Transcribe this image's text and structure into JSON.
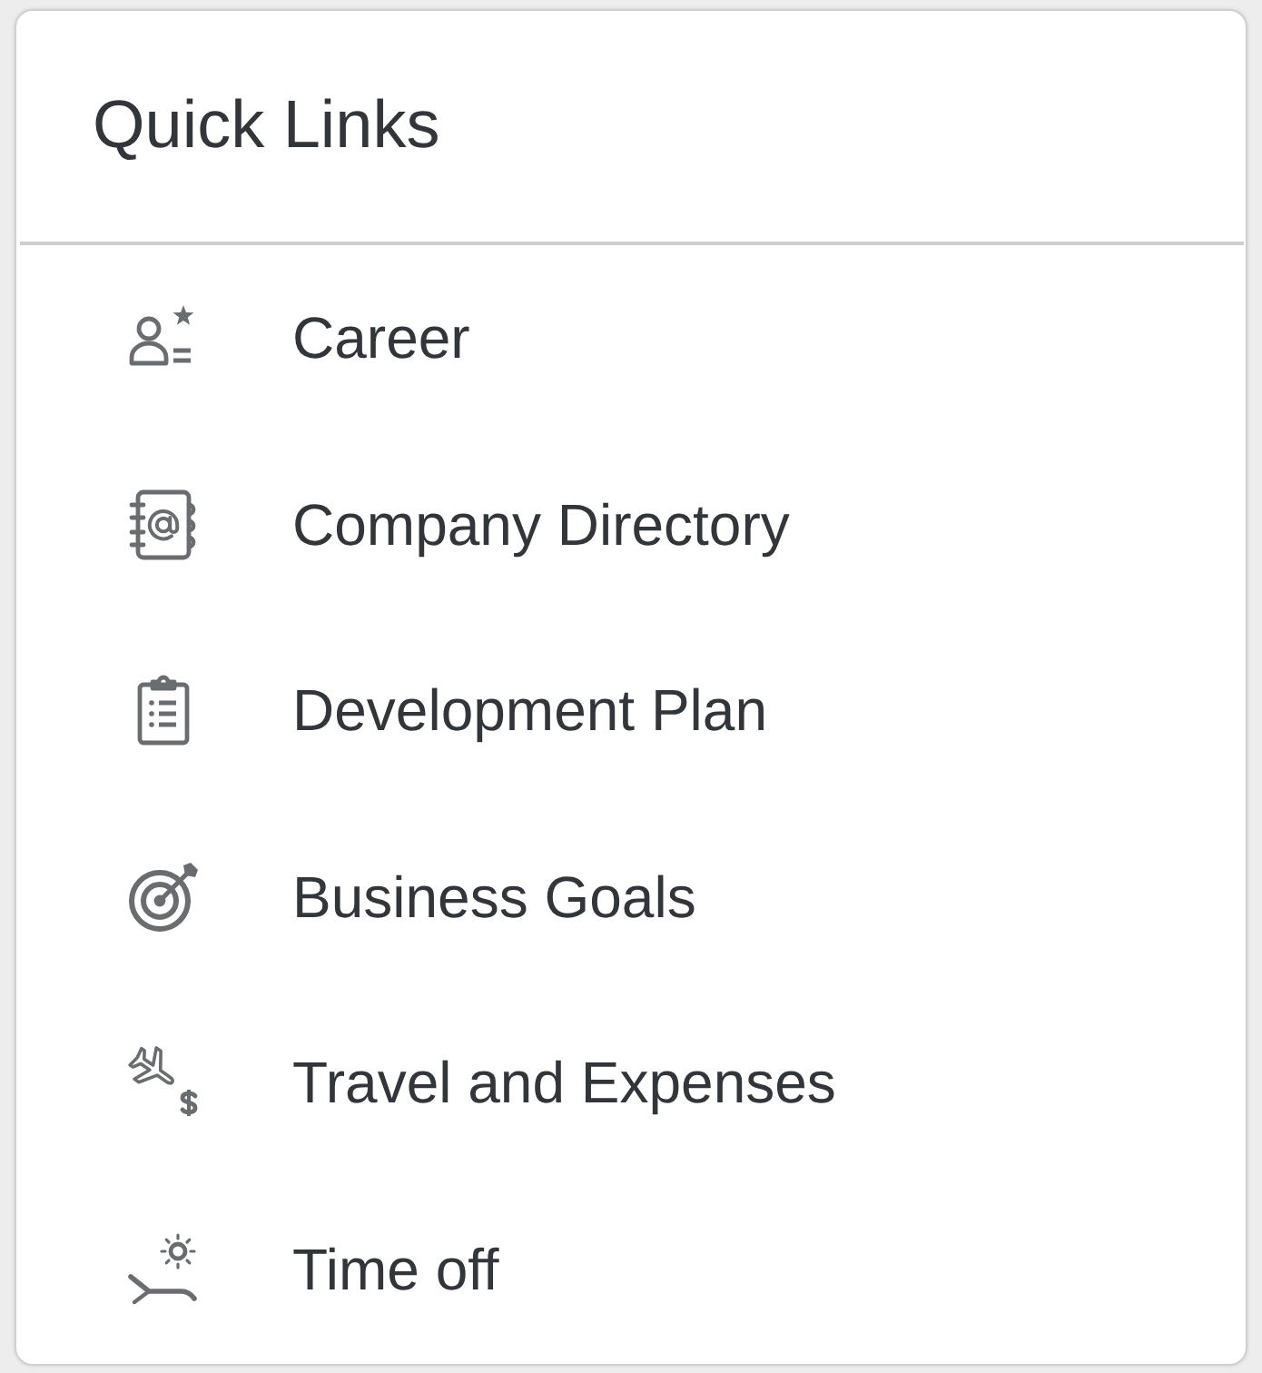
{
  "card": {
    "title": "Quick Links"
  },
  "links": [
    {
      "kind": "career",
      "label": "Career"
    },
    {
      "kind": "directory",
      "label": "Company Directory"
    },
    {
      "kind": "plan",
      "label": "Development Plan"
    },
    {
      "kind": "goals",
      "label": "Business Goals"
    },
    {
      "kind": "travel",
      "label": "Travel and Expenses"
    },
    {
      "kind": "timeoff",
      "label": "Time off"
    }
  ]
}
